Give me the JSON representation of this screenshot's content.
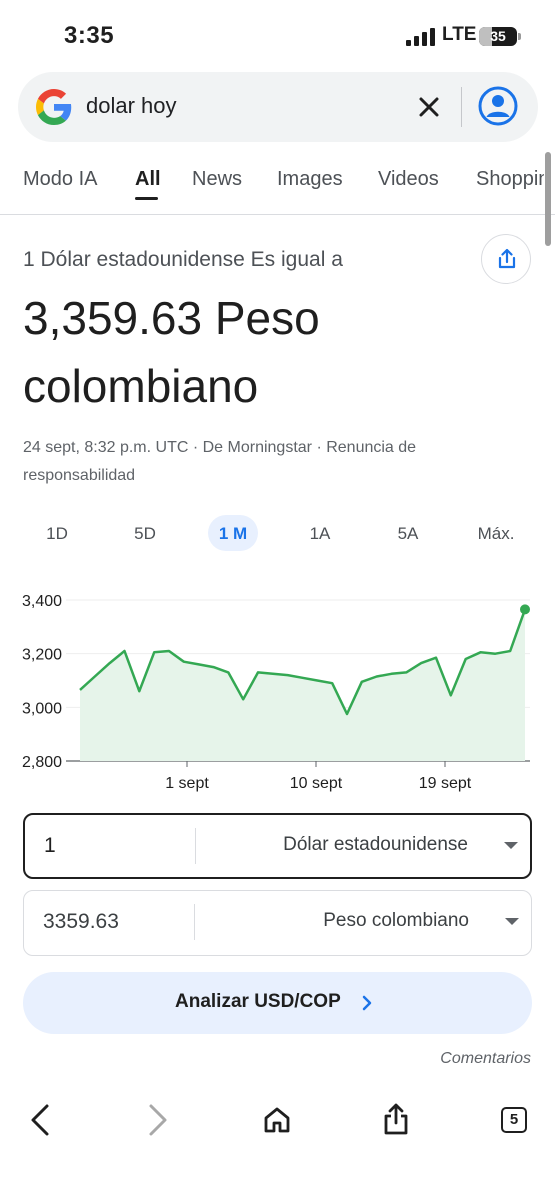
{
  "status_bar": {
    "time": "3:35",
    "carrier": "LTE",
    "battery_level": "35"
  },
  "search": {
    "query": "dolar hoy"
  },
  "tabs": [
    {
      "label": "Modo IA"
    },
    {
      "label": "All"
    },
    {
      "label": "News"
    },
    {
      "label": "Images"
    },
    {
      "label": "Videos"
    },
    {
      "label": "Shopping"
    }
  ],
  "active_tab": "All",
  "result": {
    "conversion_label": "1 Dólar estadounidense Es igual a",
    "value": "3,359.63 Peso colombiano",
    "source": "24 sept, 8:32 p.m. UTC · De Morningstar · Renuncia de responsabilidad"
  },
  "ranges": [
    {
      "label": "1D"
    },
    {
      "label": "5D"
    },
    {
      "label": "1 M"
    },
    {
      "label": "1A"
    },
    {
      "label": "5A"
    },
    {
      "label": "Máx."
    }
  ],
  "active_range": "1 M",
  "chart_data": {
    "type": "area",
    "title": "",
    "xlabel": "",
    "ylabel": "",
    "y_ticks": [
      "3,400",
      "3,200",
      "3,000",
      "2,800"
    ],
    "x_ticks": [
      "1 sept",
      "10 sept",
      "19 sept"
    ],
    "ylim": [
      2800,
      3400
    ],
    "grid": true,
    "color": "#34a853",
    "fill": "#e6f4ea",
    "series": [
      {
        "values": [
          3065,
          3115,
          3165,
          3210,
          3060,
          3205,
          3210,
          3170,
          3160,
          3150,
          3130,
          3030,
          3130,
          3125,
          3120,
          3110,
          3100,
          3090,
          2975,
          3095,
          3115,
          3125,
          3130,
          3165,
          3185,
          3045,
          3180,
          3205,
          3200,
          3210,
          3365
        ]
      }
    ]
  },
  "converter": {
    "from_amount": "1",
    "from_currency": "Dólar estadounidense",
    "to_amount": "3359.63",
    "to_currency": "Peso colombiano"
  },
  "analyze_label": "Analizar USD/COP",
  "feedback_label": "Comentarios",
  "toolbar": {
    "tab_count": "5"
  },
  "colors": {
    "accent": "#1a73e8",
    "chart_line": "#34a853",
    "chip_bg": "#e8f0fe"
  }
}
